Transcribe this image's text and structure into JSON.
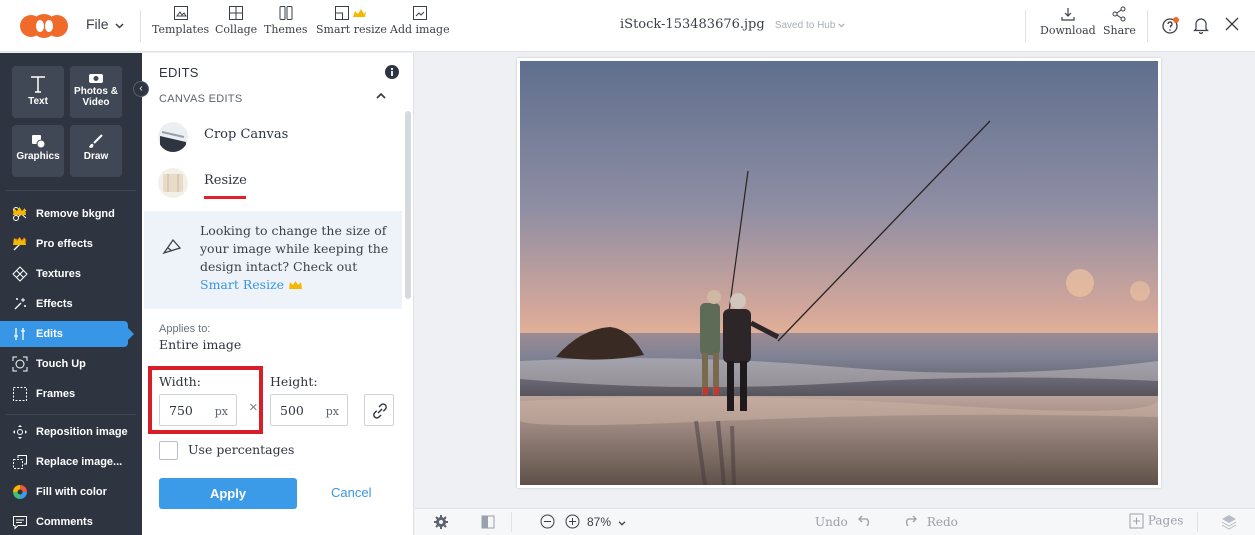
{
  "app": {
    "file_menu": "File",
    "accent": "#3796e6",
    "highlight": "#d81e28"
  },
  "top_tools": [
    {
      "label": "Templates",
      "icon": "templates-icon"
    },
    {
      "label": "Collage",
      "icon": "collage-icon"
    },
    {
      "label": "Themes",
      "icon": "themes-icon"
    },
    {
      "label": "Smart resize",
      "icon": "smart-resize-icon",
      "premium": true
    },
    {
      "label": "Add image",
      "icon": "add-image-icon"
    }
  ],
  "document": {
    "filename": "iStock-153483676.jpg",
    "save_status": "Saved to Hub"
  },
  "top_right": {
    "download": "Download",
    "share": "Share"
  },
  "left_tiles": [
    {
      "label": "Text",
      "icon": "text-icon"
    },
    {
      "label": "Photos & Video",
      "icon": "camera-icon"
    },
    {
      "label": "Graphics",
      "icon": "graphics-icon"
    },
    {
      "label": "Draw",
      "icon": "brush-icon"
    }
  ],
  "left_items": [
    {
      "label": "Remove bkgnd",
      "icon": "scissors-icon",
      "premium": true
    },
    {
      "label": "Pro effects",
      "icon": "wand-icon",
      "premium": true
    },
    {
      "label": "Textures",
      "icon": "textures-icon"
    },
    {
      "label": "Effects",
      "icon": "sparkle-icon"
    },
    {
      "label": "Edits",
      "icon": "edits-icon",
      "active": true
    },
    {
      "label": "Touch Up",
      "icon": "face-icon"
    },
    {
      "label": "Frames",
      "icon": "frame-icon"
    },
    {
      "label": "Reposition image",
      "icon": "reposition-icon"
    },
    {
      "label": "Replace image...",
      "icon": "replace-icon"
    },
    {
      "label": "Fill with color",
      "icon": "color-wheel-icon"
    },
    {
      "label": "Comments",
      "icon": "comment-icon"
    }
  ],
  "panel": {
    "title": "EDITS",
    "section": "CANVAS EDITS",
    "rows": [
      {
        "label": "Crop Canvas"
      },
      {
        "label": "Resize"
      }
    ],
    "hint_text": "Looking to change the size of your image while keeping the design intact? Check out",
    "hint_link": "Smart Resize",
    "applies_label": "Applies to:",
    "applies_value": "Entire image",
    "width_label": "Width:",
    "width_value": "750",
    "height_label": "Height:",
    "height_value": "500",
    "unit": "px",
    "use_percentages": "Use percentages",
    "apply": "Apply",
    "cancel": "Cancel"
  },
  "bottom": {
    "zoom": "87%",
    "undo": "Undo",
    "redo": "Redo",
    "pages": "Pages"
  }
}
